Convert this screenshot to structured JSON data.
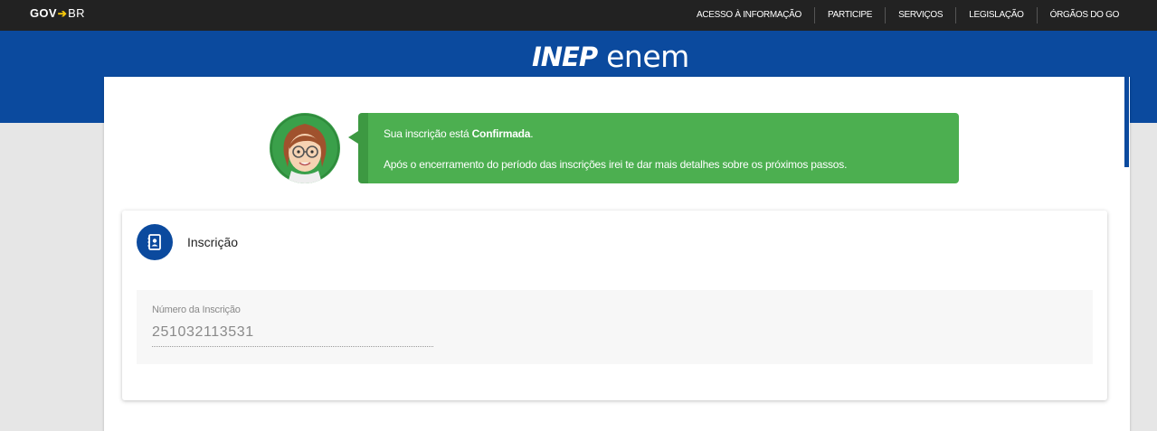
{
  "govbar": {
    "logo_gov": "GOV",
    "logo_br": "BR",
    "links": [
      "ACESSO À INFORMAÇÃO",
      "PARTICIPE",
      "SERVIÇOS",
      "LEGISLAÇÃO",
      "ÓRGÃOS DO GO"
    ]
  },
  "header": {
    "brand_inep": "INEP",
    "brand_enem": "enem",
    "color": "#0b4a9e"
  },
  "message": {
    "line1_prefix": "Sua inscrição está ",
    "line1_status": "Confirmada",
    "line1_suffix": ".",
    "line2": "Após o encerramento do período das inscrições irei te dar mais detalhes sobre os próximos passos.",
    "color": "#4caf50"
  },
  "panel": {
    "icon": "contact-card-icon",
    "title": "Inscrição",
    "field_label": "Número da Inscrição",
    "field_value": "251032113531"
  }
}
